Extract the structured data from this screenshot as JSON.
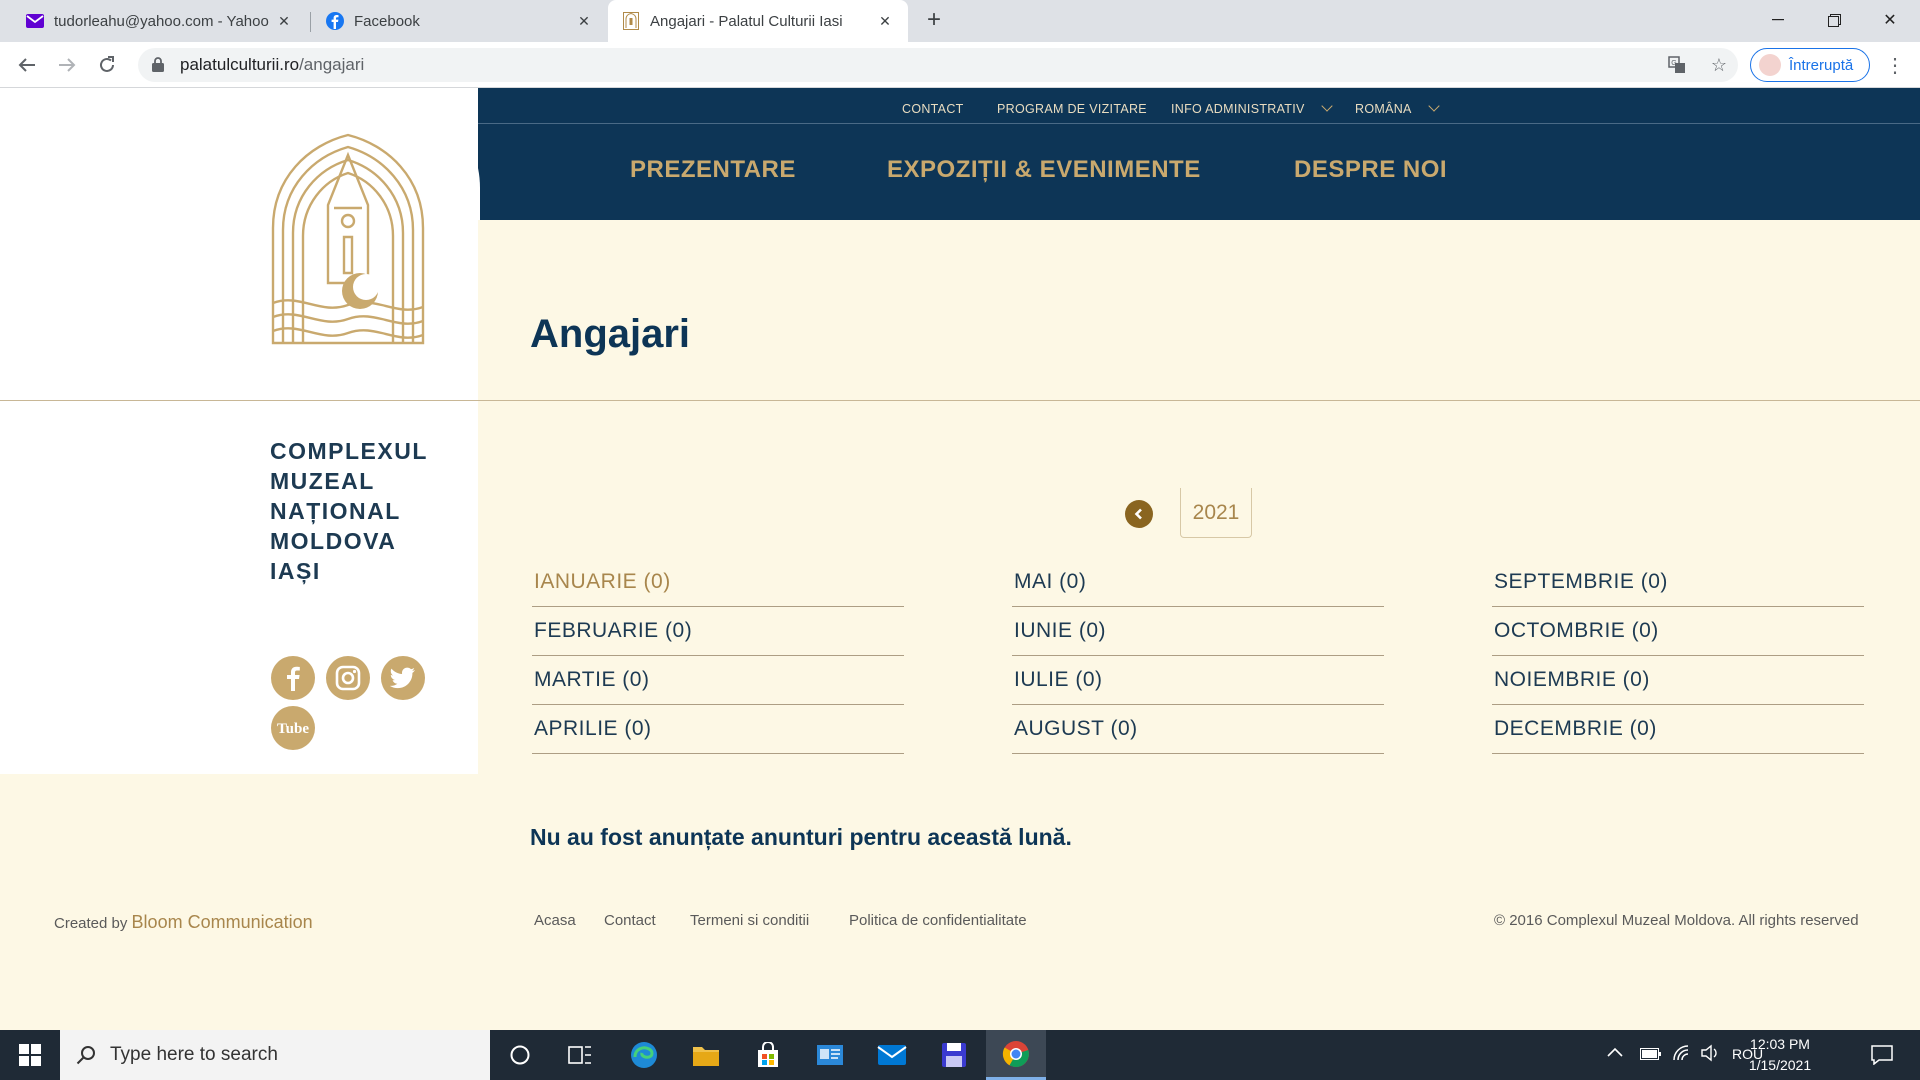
{
  "browser": {
    "tabs": [
      {
        "title": "tudorleahu@yahoo.com - Yahoo",
        "active": false
      },
      {
        "title": "Facebook",
        "active": false
      },
      {
        "title": "Angajari - Palatul Culturii Iasi",
        "active": true
      }
    ],
    "url_host": "palatulculturii.ro",
    "url_path": "/angajari",
    "profile_label": "Întreruptă"
  },
  "site": {
    "utility_nav": [
      "CONTACT",
      "PROGRAM DE VIZITARE",
      "INFO ADMINISTRATIV",
      "ROMÂNA"
    ],
    "main_nav": [
      "PREZENTARE",
      "EXPOZIȚII & EVENIMENTE",
      "DESPRE NOI"
    ],
    "brand_lines": [
      "COMPLEXUL",
      "MUZEAL",
      "NAȚIONAL",
      "MOLDOVA",
      "IAȘI"
    ],
    "page_title": "Angajari",
    "year": "2021",
    "months": [
      [
        "IANUARIE (0)",
        "FEBRUARIE (0)",
        "MARTIE (0)",
        "APRILIE (0)"
      ],
      [
        "MAI (0)",
        "IUNIE (0)",
        "IULIE (0)",
        "AUGUST (0)"
      ],
      [
        "SEPTEMBRIE (0)",
        "OCTOMBRIE (0)",
        "NOIEMBRIE (0)",
        "DECEMBRIE (0)"
      ]
    ],
    "current_month": "IANUARIE (0)",
    "notice": "Nu au fost anunțate anunturi pentru această lună.",
    "social": [
      "facebook",
      "instagram",
      "twitter",
      "youtube"
    ],
    "footer": {
      "created_by_prefix": "Created by",
      "created_by_name": "Bloom Communication",
      "links": [
        "Acasa",
        "Contact",
        "Termeni si conditii",
        "Politica de confidentialitate"
      ],
      "copyright": "© 2016 Complexul Muzeal Moldova. All rights reserved"
    },
    "colors": {
      "navy": "#0d3556",
      "gold": "#c9a96e",
      "cream": "#fdf8e5"
    }
  },
  "taskbar": {
    "search_placeholder": "Type here to search",
    "language": "ROU",
    "time": "12:03 PM",
    "date": "1/15/2021"
  }
}
